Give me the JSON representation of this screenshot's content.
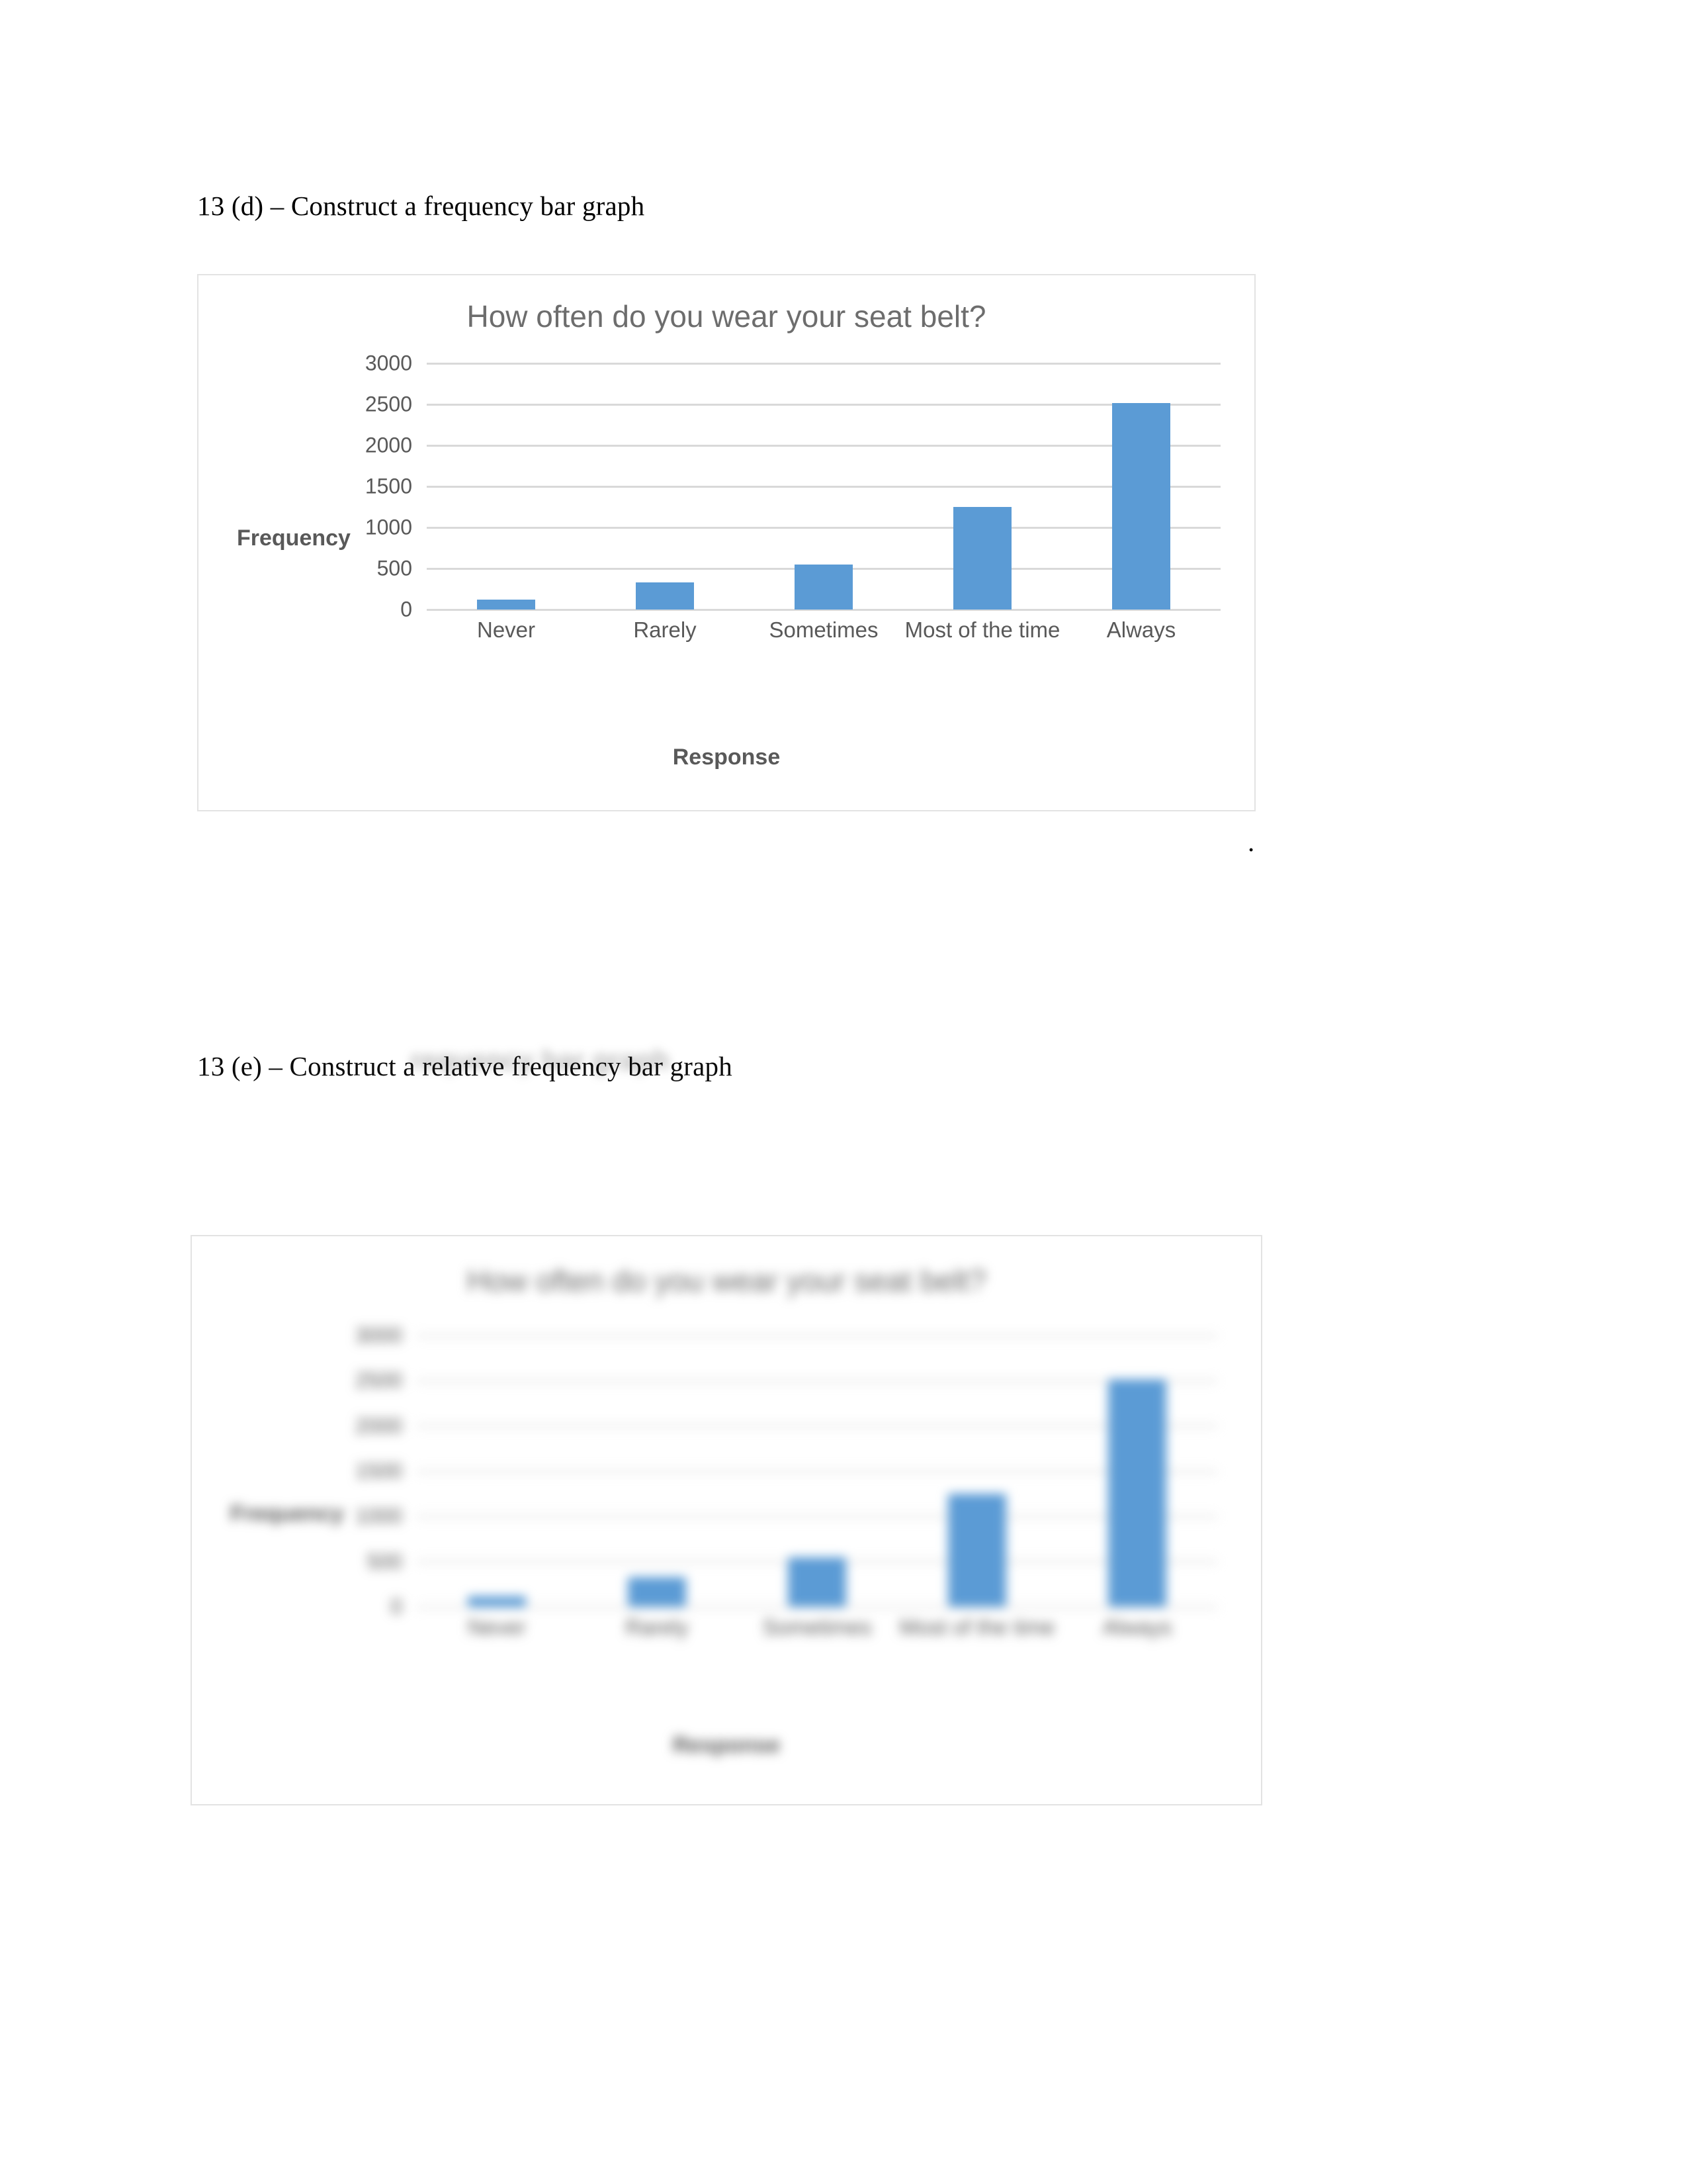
{
  "document": {
    "heading_d": "13 (d) – Construct a frequency bar graph",
    "heading_e": "13 (e) – Construct a relative frequency bar graph",
    "period_mark": ".",
    "ghost_title": "requency bar graph"
  },
  "colors": {
    "bar": "#5B9BD5",
    "gridline": "#d9d9d9",
    "axis_text": "#595959",
    "title_text": "#6d6d6d",
    "chart_border": "#e3e3e3"
  },
  "chart_data": [
    {
      "id": "frequency-bar-graph",
      "type": "bar",
      "title": "How often do you wear your seat belt?",
      "xlabel": "Response",
      "ylabel": "Frequency",
      "categories": [
        "Never",
        "Rarely",
        "Sometimes",
        "Most of the time",
        "Always"
      ],
      "values": [
        120,
        330,
        550,
        1250,
        2520
      ],
      "ylim": [
        0,
        3000
      ],
      "yticks": [
        3000,
        2500,
        2000,
        1500,
        1000,
        500,
        0
      ],
      "ytick_labels": [
        "3000",
        "2500",
        "2000",
        "1500",
        "1000",
        "500",
        "0"
      ],
      "grid": true,
      "legend": false,
      "bar_color": "#5B9BD5"
    },
    {
      "id": "relative-frequency-bar-graph",
      "type": "bar",
      "title": "How often do you wear your seat belt?",
      "xlabel": "Response",
      "ylabel": "Frequency",
      "categories": [
        "Never",
        "Rarely",
        "Sometimes",
        "Most of the time",
        "Always"
      ],
      "values": [
        120,
        330,
        550,
        1250,
        2520
      ],
      "ylim": [
        0,
        3000
      ],
      "yticks": [
        3000,
        2500,
        2000,
        1500,
        1000,
        500,
        0
      ],
      "ytick_labels": [
        "3000",
        "2500",
        "2000",
        "1500",
        "1000",
        "500",
        "0"
      ],
      "grid": true,
      "legend": false,
      "blurred": true,
      "bar_color": "#5B9BD5"
    }
  ]
}
